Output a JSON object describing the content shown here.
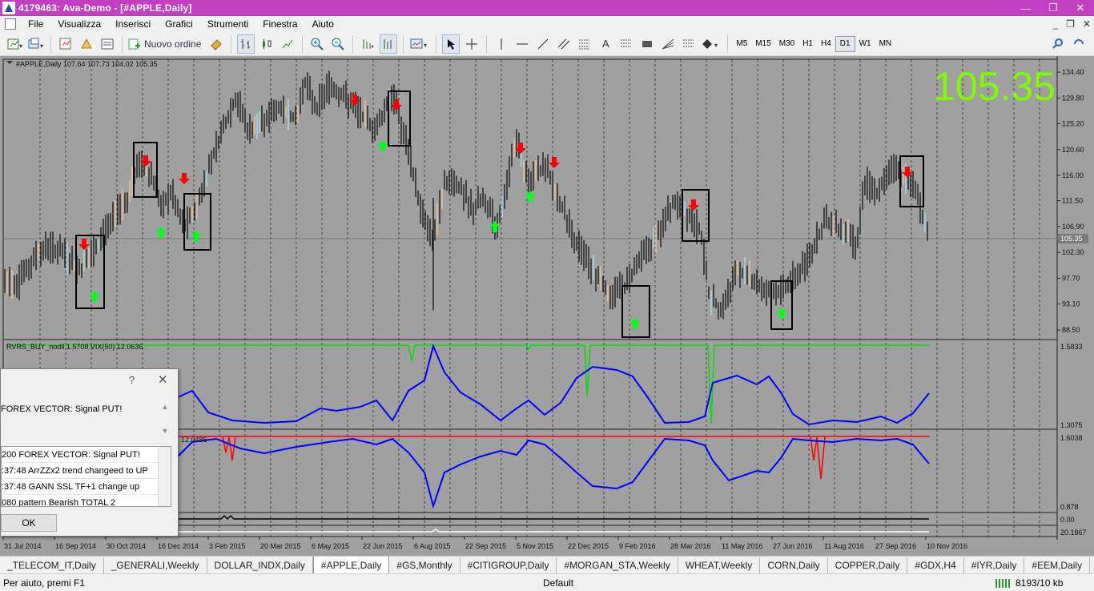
{
  "window": {
    "title": "4179463: Ava-Demo - [#APPLE,Daily]",
    "controls": [
      "—",
      "❐",
      "✕"
    ]
  },
  "menu": {
    "items": [
      "File",
      "Visualizza",
      "Inserisci",
      "Grafici",
      "Strumenti",
      "Finestra",
      "Aiuto"
    ],
    "mdi_controls": [
      "_",
      "❐",
      "✕"
    ]
  },
  "toolbar": {
    "new_order_label": "Nuovo ordine",
    "draw_text_tool": "A",
    "timeframes": [
      "M5",
      "M15",
      "M30",
      "H1",
      "H4",
      "D1",
      "W1",
      "MN"
    ],
    "active_timeframe": "D1",
    "icons": [
      "new-chart-icon",
      "profiles-icon",
      "market-watch-icon",
      "navigator-icon",
      "terminal-icon",
      "new-order-icon",
      "autotrading-icon",
      "bar-chart-icon",
      "candlestick-icon",
      "line-chart-icon",
      "zoom-in-icon",
      "zoom-out-icon",
      "chart-shift-icon",
      "autoscroll-icon",
      "templates-icon",
      "cursor-icon",
      "crosshair-icon",
      "vertical-line-icon",
      "horizontal-line-icon",
      "trendline-icon",
      "equidistant-channel-icon",
      "fibonacci-icon",
      "text-icon",
      "label-icon",
      "shapes-icon",
      "search-icon"
    ]
  },
  "chart": {
    "symbol_header": "#APPLE,Daily  107.64 107.73 104.02 105.35",
    "big_price": "105.35",
    "current_price_label": "105.35",
    "price_axis": [
      "134.40",
      "129.80",
      "125.20",
      "120.60",
      "116.00",
      "111.50",
      "106.90",
      "102.30",
      "97.70",
      "93.10",
      "88.50"
    ],
    "date_axis": [
      "31 Jul 2014",
      "16 Sep 2014",
      "30 Oct 2014",
      "16 Dec 2014",
      "3 Feb 2015",
      "20 Mar 2015",
      "6 May 2015",
      "22 Jun 2015",
      "6 Aug 2015",
      "22 Sep 2015",
      "5 Nov 2015",
      "22 Dec 2015",
      "9 Feb 2016",
      "28 Mar 2016",
      "11 May 2016",
      "27 Jun 2016",
      "11 Aug 2016",
      "27 Sep 2016",
      "10 Nov 2016"
    ],
    "indicator1_header": "RVRS_BUY_nodll 1.5708  VIX(50) 12.0636",
    "indicator1_axis": [
      "1.5833",
      "1.3075"
    ],
    "indicator2_header": "12.0486",
    "indicator2_axis": [
      "1.6038",
      "0.878"
    ],
    "indicator3_axis": [
      "0.00"
    ],
    "indicator4_axis": [
      "20.1867",
      "7.5"
    ],
    "colors": {
      "up_arrow": "#00ff1a",
      "down_arrow": "#ff0000",
      "indicator_line": "#0000ff",
      "signal_line": "#ff0000",
      "buy_line": "#00e000",
      "big_price": "#7cfc00",
      "background": "#a0a0a0"
    },
    "chart_data": {
      "type": "bar",
      "series": [
        {
          "name": "#APPLE,Daily",
          "last": 105.35,
          "open": 107.64,
          "high": 107.73,
          "low": 104.02
        }
      ],
      "ylim": [
        88.5,
        134.4
      ],
      "x_range": [
        "31 Jul 2014",
        "10 Nov 2016"
      ],
      "grid": true
    }
  },
  "alert": {
    "help": "?",
    "close": "✕",
    "message": "FOREX VECTOR: Signal PUT!",
    "log_rows": [
      "200   FOREX VECTOR: Signal PUT!",
      ":37:48 ArrZZx2  trend changeed to UP",
      ":37:48 GANN SSL TF+1 change up",
      "080 pattern Bearish TOTAL 2"
    ],
    "ok_label": "OK"
  },
  "tabs": [
    "_TELECOM_IT,Daily",
    "_GENERALI,Weekly",
    "DOLLAR_INDX,Daily",
    "#APPLE,Daily",
    "#GS,Monthly",
    "#CITIGROUP,Daily",
    "#MORGAN_STA,Weekly",
    "WHEAT,Weekly",
    "CORN,Daily",
    "COPPER,Daily",
    "#GDX,H4",
    "#IYR,Daily",
    "#EEM,Daily"
  ],
  "active_tab": "#APPLE,Daily",
  "status": {
    "help": "Per aiuto, premi F1",
    "profile": "Default",
    "traffic": "8193/10 kb"
  }
}
